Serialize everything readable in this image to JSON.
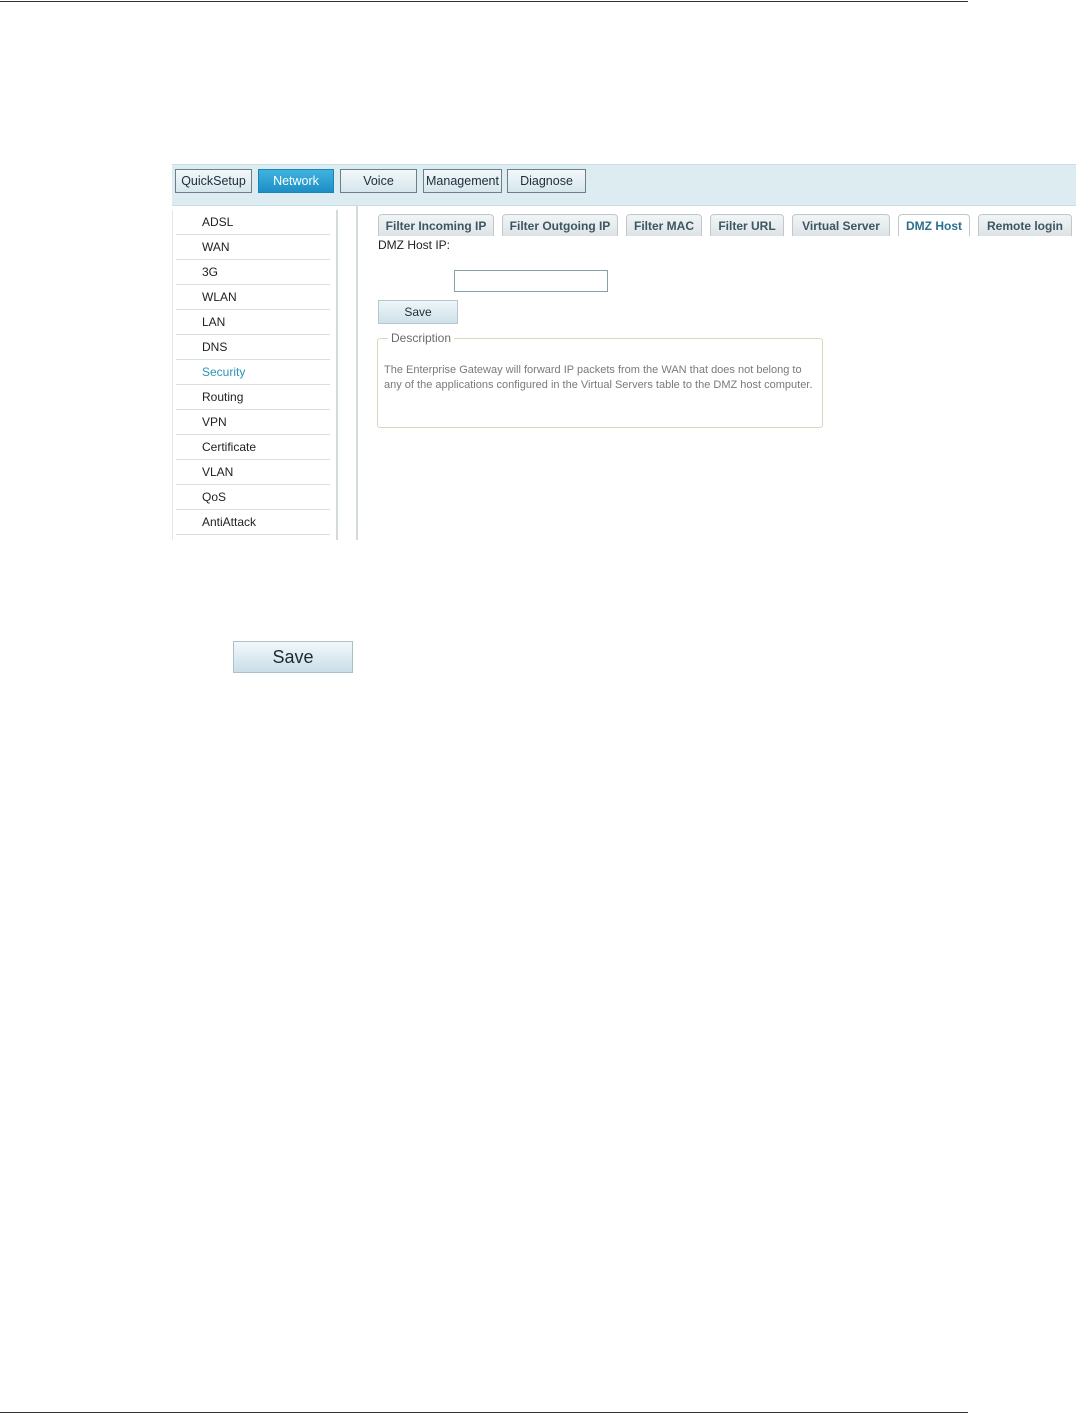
{
  "topnav": {
    "tabs": [
      {
        "label": "QuickSetup"
      },
      {
        "label": "Network"
      },
      {
        "label": "Voice"
      },
      {
        "label": "Management"
      },
      {
        "label": "Diagnose"
      }
    ],
    "active_tab": "Network"
  },
  "sidebar": {
    "items": [
      {
        "label": "ADSL"
      },
      {
        "label": "WAN"
      },
      {
        "label": "3G"
      },
      {
        "label": "WLAN"
      },
      {
        "label": "LAN"
      },
      {
        "label": "DNS"
      },
      {
        "label": "Security"
      },
      {
        "label": "Routing"
      },
      {
        "label": "VPN"
      },
      {
        "label": "Certificate"
      },
      {
        "label": "VLAN"
      },
      {
        "label": "QoS"
      },
      {
        "label": "AntiAttack"
      }
    ],
    "active_item": "Security"
  },
  "subtabs": {
    "items": [
      {
        "label": "Filter Incoming IP"
      },
      {
        "label": "Filter Outgoing IP"
      },
      {
        "label": "Filter MAC"
      },
      {
        "label": "Filter URL"
      },
      {
        "label": "Virtual Server"
      },
      {
        "label": "DMZ Host"
      },
      {
        "label": "Remote login"
      }
    ],
    "active": "DMZ Host"
  },
  "form": {
    "dmz_label": "DMZ Host IP:",
    "dmz_value": "",
    "save_label": "Save"
  },
  "description": {
    "legend": "Description",
    "text": "The Enterprise Gateway will forward IP packets from the WAN that does not belong to any of the applications configured in the Virtual Servers table to the DMZ host computer."
  },
  "standalone_button": {
    "label": "Save"
  },
  "colors": {
    "nav_bg": "#dcecf1",
    "active_tab": "#2a9fd4",
    "active_sidebar": "#2b95b8"
  }
}
